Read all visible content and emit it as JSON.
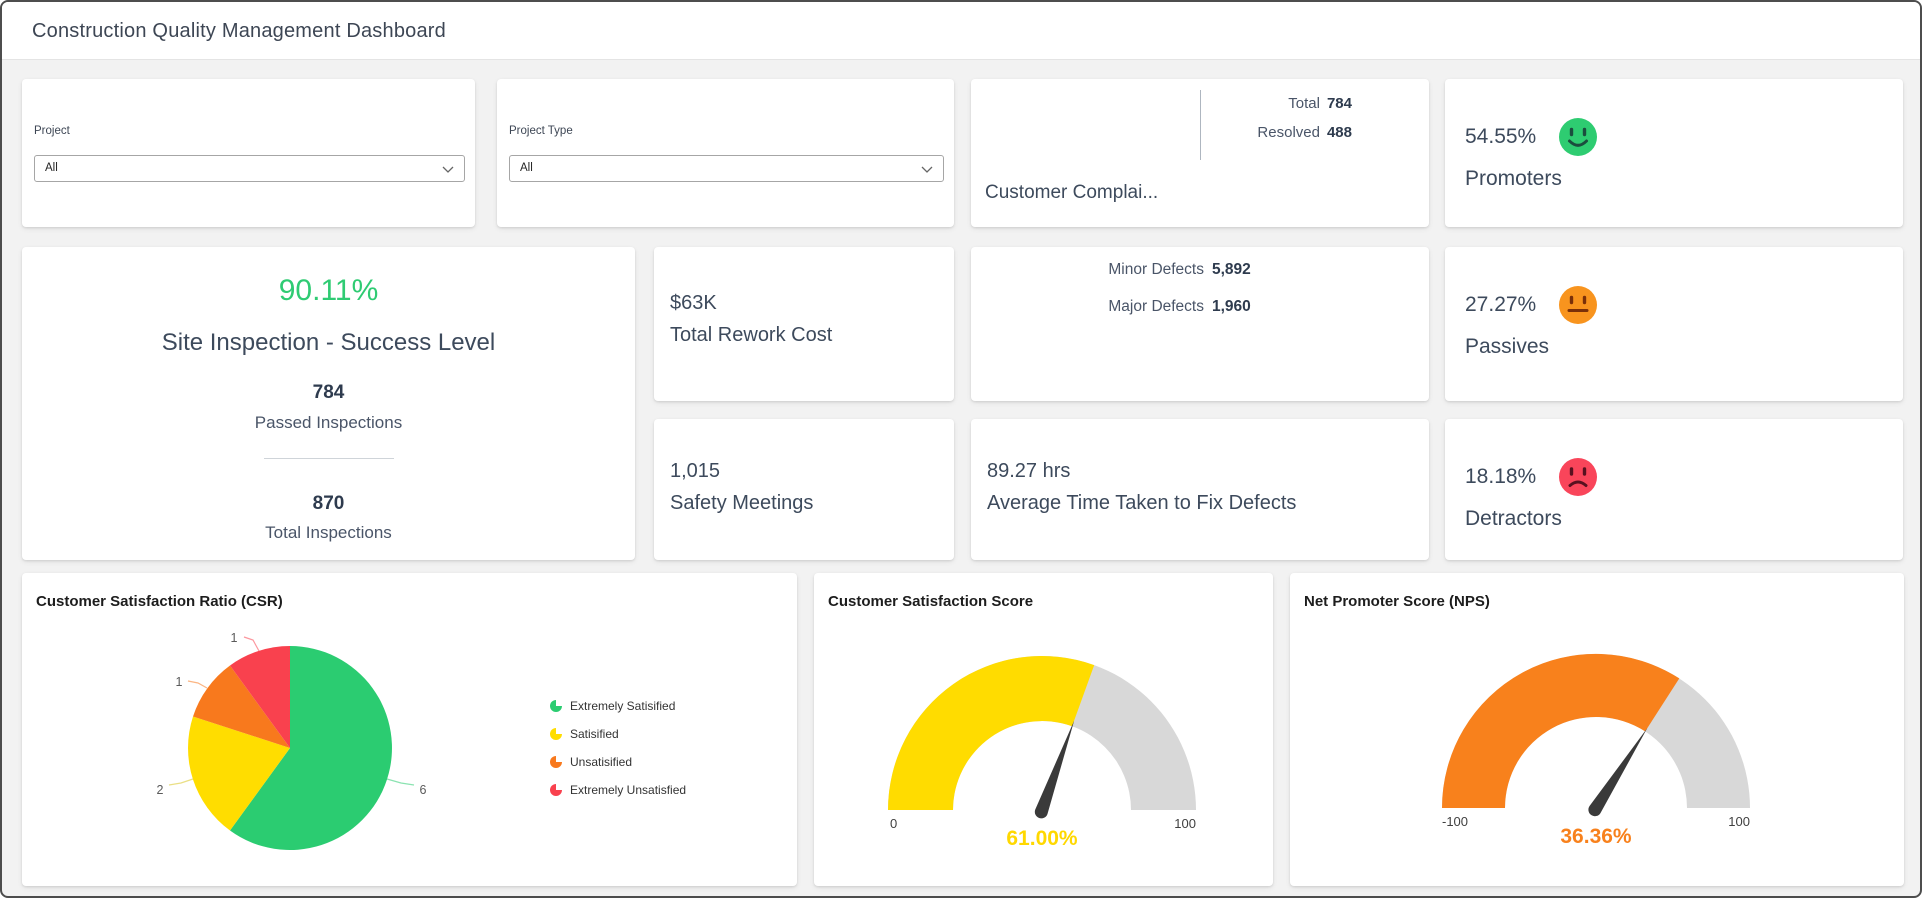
{
  "header": {
    "title": "Construction Quality Management Dashboard"
  },
  "filters": {
    "project": {
      "label": "Project",
      "value": "All"
    },
    "project_type": {
      "label": "Project Type",
      "value": "All"
    }
  },
  "complaints": {
    "title": "Customer Complai...",
    "rows": [
      {
        "label": "Total",
        "value": "784"
      },
      {
        "label": "Resolved",
        "value": "488"
      }
    ]
  },
  "moods": [
    {
      "pct": "54.55%",
      "label": "Promoters",
      "mood": "happy",
      "color": "#2ecc71"
    },
    {
      "pct": "27.27%",
      "label": "Passives",
      "mood": "neutral",
      "color": "#f8941e"
    },
    {
      "pct": "18.18%",
      "label": "Detractors",
      "mood": "sad",
      "color": "#f9455a"
    }
  ],
  "site_inspection": {
    "pct": "90.11%",
    "title": "Site Inspection - Success Level",
    "passed_value": "784",
    "passed_label": "Passed Inspections",
    "total_value": "870",
    "total_label": "Total Inspections"
  },
  "kpis": {
    "rework": {
      "value": "$63K",
      "label": "Total Rework Cost"
    },
    "safety": {
      "value": "1,015",
      "label": "Safety Meetings"
    },
    "fixtime": {
      "value": "89.27 hrs",
      "label": "Average Time Taken to Fix Defects"
    }
  },
  "defects": {
    "rows": [
      {
        "label": "Minor Defects",
        "value": "5,892"
      },
      {
        "label": "Major Defects",
        "value": "1,960"
      }
    ]
  },
  "chart_data": [
    {
      "type": "pie",
      "title": "Customer Satisfaction Ratio (CSR)",
      "labels": [
        "Extremely Satisified",
        "Satisified",
        "Unsatisified",
        "Extremely Unsatisfied"
      ],
      "values": [
        6,
        2,
        1,
        1
      ],
      "colors": [
        "#2bcc71",
        "#ffdd00",
        "#f8791d",
        "#f9414e"
      ],
      "legend_position": "right"
    },
    {
      "type": "gauge",
      "title": "Customer Satisfaction Score",
      "value": 61.0,
      "display": "61.00%",
      "min": 0,
      "max": 100,
      "fill_color": "#ffdc00",
      "track_color": "#d8d8d8"
    },
    {
      "type": "gauge",
      "title": "Net Promoter Score (NPS)",
      "value": 36.36,
      "display": "36.36%",
      "min": -100,
      "max": 100,
      "fill_color": "#f8811c",
      "track_color": "#d8d8d8"
    }
  ]
}
